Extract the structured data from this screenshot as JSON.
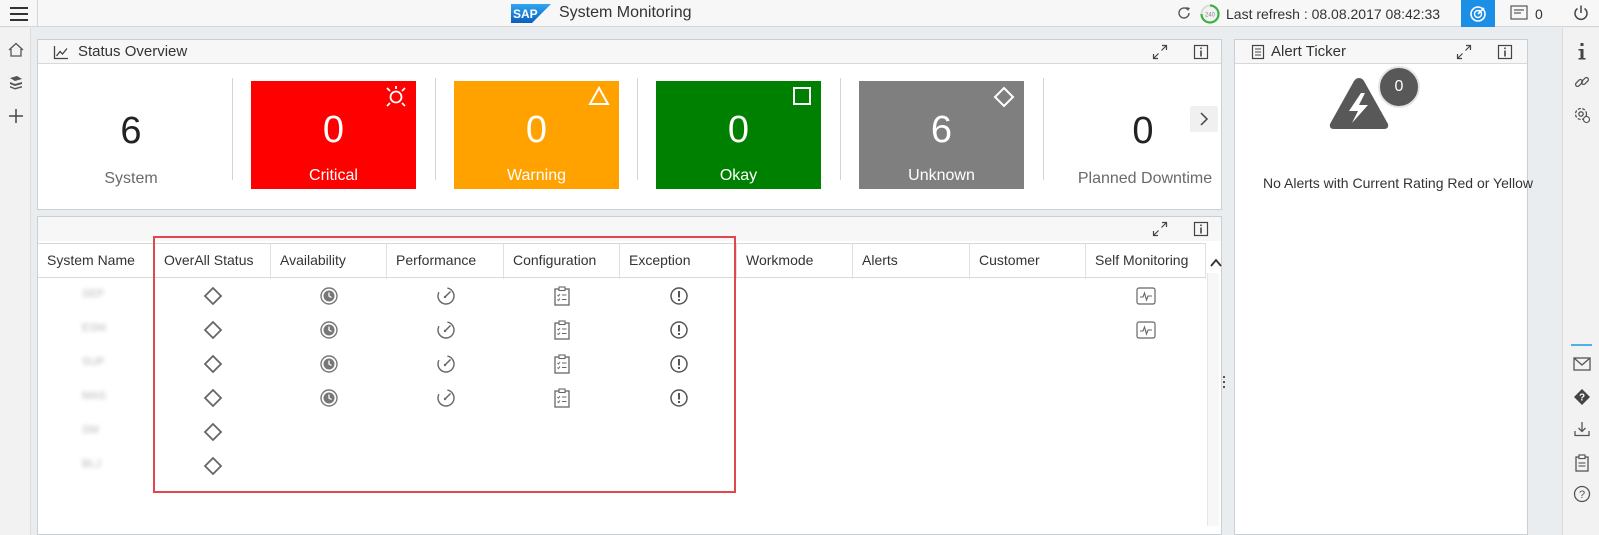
{
  "shell": {
    "logo_text": "SAP",
    "title": "System Monitoring",
    "ring_counter": "240",
    "last_refresh": "Last refresh : 08.08.2017 08:42:33",
    "notification_count": "0"
  },
  "status_overview": {
    "title": "Status Overview",
    "system": {
      "value": "6",
      "label": "System"
    },
    "tiles": [
      {
        "value": "0",
        "label": "Critical",
        "color": "#ff0000",
        "icon": "critical-sun-icon"
      },
      {
        "value": "0",
        "label": "Warning",
        "color": "#ffa200",
        "icon": "warning-triangle-icon"
      },
      {
        "value": "0",
        "label": "Okay",
        "color": "#008000",
        "icon": "okay-square-icon"
      },
      {
        "value": "6",
        "label": "Unknown",
        "color": "#7f7f7f",
        "icon": "unknown-diamond-icon"
      }
    ],
    "planned": {
      "value": "0",
      "label": "Planned Downtime"
    }
  },
  "table": {
    "columns": [
      "System Name",
      "OverAll Status",
      "Availability",
      "Performance",
      "Configuration",
      "Exception",
      "Workmode",
      "Alerts",
      "Customer",
      "Self Monitoring"
    ],
    "rows": [
      {
        "system": "SEP",
        "overall": "unknown-diamond-icon",
        "availability": true,
        "performance": true,
        "configuration": true,
        "exception": true,
        "self_monitoring": true
      },
      {
        "system": "ESM",
        "overall": "unknown-diamond-icon",
        "availability": true,
        "performance": true,
        "configuration": true,
        "exception": true,
        "self_monitoring": true
      },
      {
        "system": "SUP",
        "overall": "unknown-diamond-icon",
        "availability": true,
        "performance": true,
        "configuration": true,
        "exception": true,
        "self_monitoring": false
      },
      {
        "system": "MAS",
        "overall": "unknown-diamond-icon",
        "availability": true,
        "performance": true,
        "configuration": true,
        "exception": true,
        "self_monitoring": false
      },
      {
        "system": "SM",
        "overall": "unknown-diamond-icon",
        "availability": false,
        "performance": false,
        "configuration": false,
        "exception": false,
        "self_monitoring": false
      },
      {
        "system": "BLJ",
        "overall": "unknown-diamond-icon",
        "availability": false,
        "performance": false,
        "configuration": false,
        "exception": false,
        "self_monitoring": false
      }
    ]
  },
  "alert_ticker": {
    "title": "Alert Ticker",
    "count": "0",
    "message": "No Alerts with Current Rating Red or Yellow"
  },
  "colors": {
    "accent": "#1b8ee6",
    "highlight_box": "#e04850"
  }
}
